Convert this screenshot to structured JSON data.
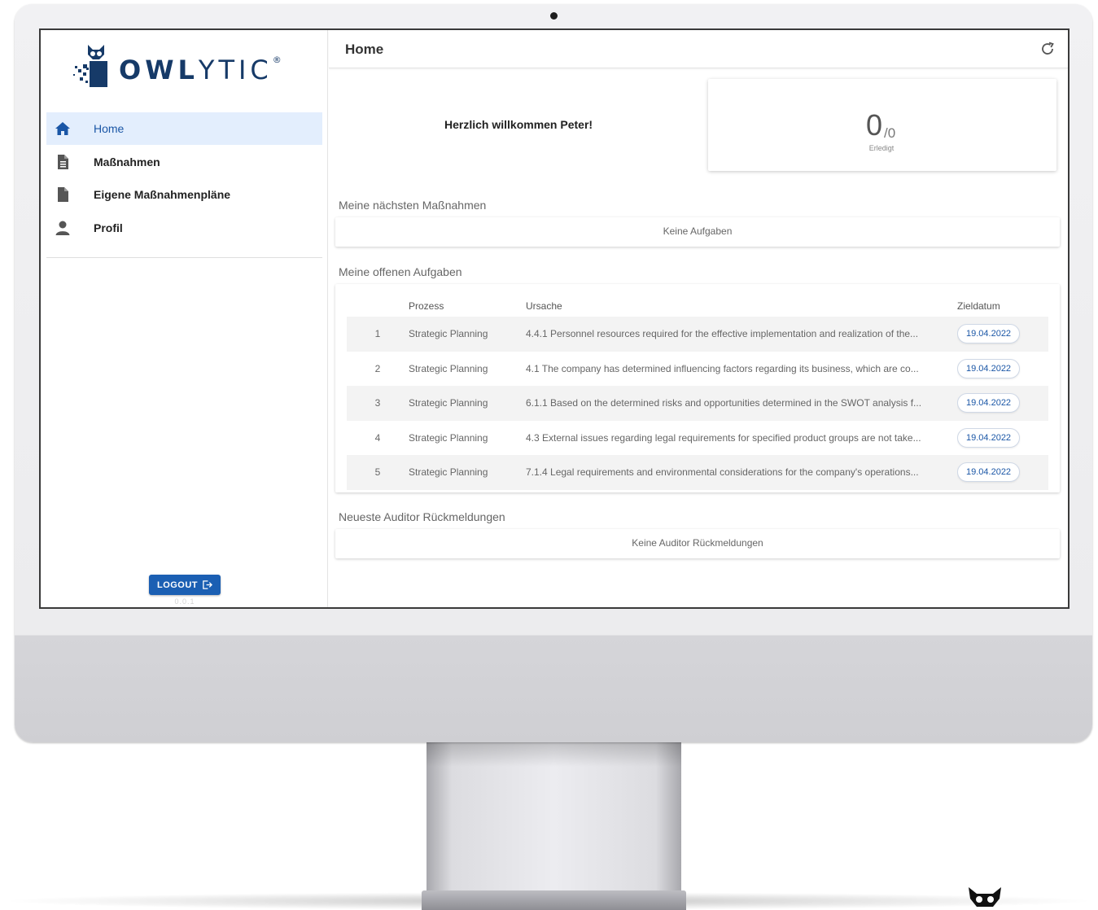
{
  "brand": {
    "name_bold": "OWL",
    "name_light": "YTIC",
    "registered": "®"
  },
  "sidebar": {
    "items": [
      {
        "label": "Home",
        "icon": "home-icon",
        "active": true
      },
      {
        "label": "Maßnahmen",
        "icon": "document-icon",
        "active": false
      },
      {
        "label": "Eigene Maßnahmenpläne",
        "icon": "document-icon",
        "active": false
      },
      {
        "label": "Profil",
        "icon": "person-icon",
        "active": false
      }
    ],
    "logout_label": "LOGOUT",
    "version": "0.0.1"
  },
  "header": {
    "title": "Home",
    "refresh_icon": "refresh-icon"
  },
  "welcome": {
    "text": "Herzlich willkommen Peter!"
  },
  "stats": {
    "done": "0",
    "total": "/0",
    "label": "Erledigt"
  },
  "next_actions": {
    "title": "Meine nächsten Maßnahmen",
    "empty": "Keine Aufgaben"
  },
  "open_tasks": {
    "title": "Meine offenen Aufgaben",
    "columns": {
      "num": "",
      "process": "Prozess",
      "cause": "Ursache",
      "date": "Zieldatum"
    },
    "rows": [
      {
        "num": "1",
        "process": "Strategic Planning",
        "cause": "4.4.1 Personnel resources required for the effective implementation and realization of the...",
        "date": "19.04.2022"
      },
      {
        "num": "2",
        "process": "Strategic Planning",
        "cause": "4.1 The company has determined influencing factors regarding its business, which are co...",
        "date": "19.04.2022"
      },
      {
        "num": "3",
        "process": "Strategic Planning",
        "cause": "6.1.1 Based on the determined risks and opportunities determined in the SWOT analysis f...",
        "date": "19.04.2022"
      },
      {
        "num": "4",
        "process": "Strategic Planning",
        "cause": "4.3 External issues regarding legal requirements for specified product groups are not take...",
        "date": "19.04.2022"
      },
      {
        "num": "5",
        "process": "Strategic Planning",
        "cause": "7.1.4 Legal requirements and environmental considerations for the company's operations...",
        "date": "19.04.2022"
      }
    ]
  },
  "auditor": {
    "title": "Neueste Auditor Rückmeldungen",
    "empty": "Keine Auditor Rückmeldungen"
  },
  "colors": {
    "accent": "#1b5fb3",
    "active_bg": "#e3eefd",
    "brand_navy": "#163a68"
  }
}
